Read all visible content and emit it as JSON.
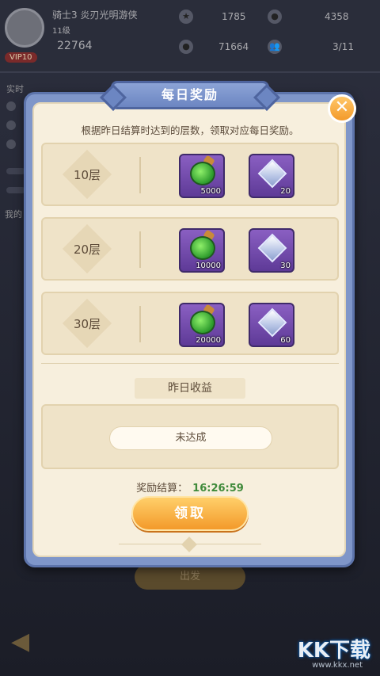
{
  "background": {
    "player_name": "骑士3 炎刃光明游侠",
    "player_level": "11级",
    "power": "22764",
    "vip": "VIP10",
    "stat_a": "1785",
    "stat_b": "4358",
    "stat_c": "71664",
    "stat_d": "3/11",
    "realtime_label": "实时",
    "side_label": "我的",
    "bottom_button": "出发"
  },
  "modal": {
    "title": "每日奖励",
    "close_label": "✕",
    "instruction": "根据昨日结算时达到的层数，领取对应每日奖励。",
    "tiers": [
      {
        "label": "10层",
        "potion_qty": "5000",
        "gem_qty": "20"
      },
      {
        "label": "20层",
        "potion_qty": "10000",
        "gem_qty": "30"
      },
      {
        "label": "30层",
        "potion_qty": "20000",
        "gem_qty": "60"
      }
    ],
    "yesterday_title": "昨日收益",
    "yesterday_status": "未达成",
    "settlement_label": "奖励结算：",
    "settlement_time": "16:26:59",
    "claim_label": "领取"
  },
  "watermark": {
    "logo": "KK下载",
    "url": "www.kkx.net"
  },
  "colors": {
    "frame": "#7f96c9",
    "panel": "#f7efdd",
    "accent": "#f39a2a",
    "timer": "#3f8a3a"
  }
}
